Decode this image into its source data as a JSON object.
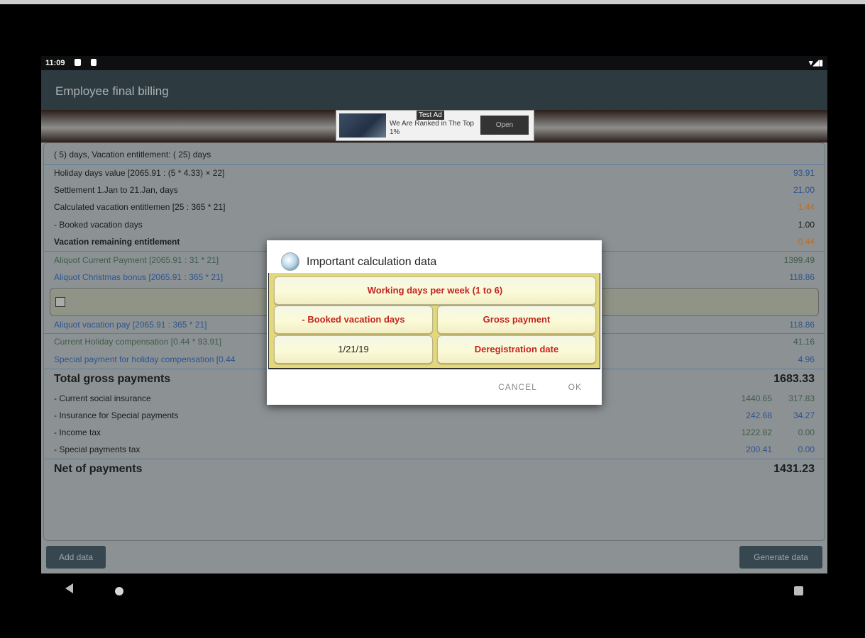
{
  "status": {
    "time": "11:09"
  },
  "appbar": {
    "title": "Employee final billing"
  },
  "ad": {
    "badge": "Test Ad",
    "text": "We Are Ranked in The Top 1%",
    "open_label": "Open"
  },
  "header_row": "( 5) days, Vacation entitlement: ( 25) days",
  "rows": [
    {
      "label": "Holiday days value [2065.91 : (5 * 4.33) × 22]",
      "value": "93.91"
    },
    {
      "label": "Settlement 1.Jan to 21.Jan, days",
      "value": "21.00"
    },
    {
      "label": "Calculated vacation entitlemen [25 : 365 * 21]",
      "value": "1.44"
    },
    {
      "label": "- Booked vacation days",
      "value": "1.00"
    },
    {
      "label": "Vacation remaining entitlement",
      "value": "0.44"
    },
    {
      "label": "Aliquot Current Payment [2065.91 : 31 * 21]",
      "value": "1399.49"
    },
    {
      "label": "Aliquot Christmas bonus [2065.91 : 365 * 21]",
      "value": "118.86"
    },
    {
      "label": "Aliquot vacation pay [2065.91 : 365 * 21]",
      "value": "118.86"
    },
    {
      "label": "Current Holiday compensation [0.44 * 93.91]",
      "value": "41.16"
    },
    {
      "label": "Special payment for holiday compensation [0.44",
      "value": "4.96"
    }
  ],
  "totals": {
    "gross_label": "Total gross payments",
    "gross_value": "1683.33",
    "deductions": [
      {
        "label": "- Current social insurance",
        "v1": "1440.65",
        "v2": "317.83"
      },
      {
        "label": "- Insurance for Special payments",
        "v1": "242.68",
        "v2": "34.27"
      },
      {
        "label": "- Income tax",
        "v1": "1222.82",
        "v2": "0.00"
      },
      {
        "label": "- Special payments tax",
        "v1": "200.41",
        "v2": "0.00"
      }
    ],
    "net_label": "Net of payments",
    "net_value": "1431.23"
  },
  "buttons": {
    "add": "Add data",
    "generate": "Generate data"
  },
  "dialog": {
    "title": "Important calculation data",
    "working_days": "Working days per week (1 to 6)",
    "booked": "- Booked vacation days",
    "gross": "Gross payment",
    "date": "1/21/19",
    "dereg": "Deregistration date",
    "cancel": "CANCEL",
    "ok": "OK"
  }
}
